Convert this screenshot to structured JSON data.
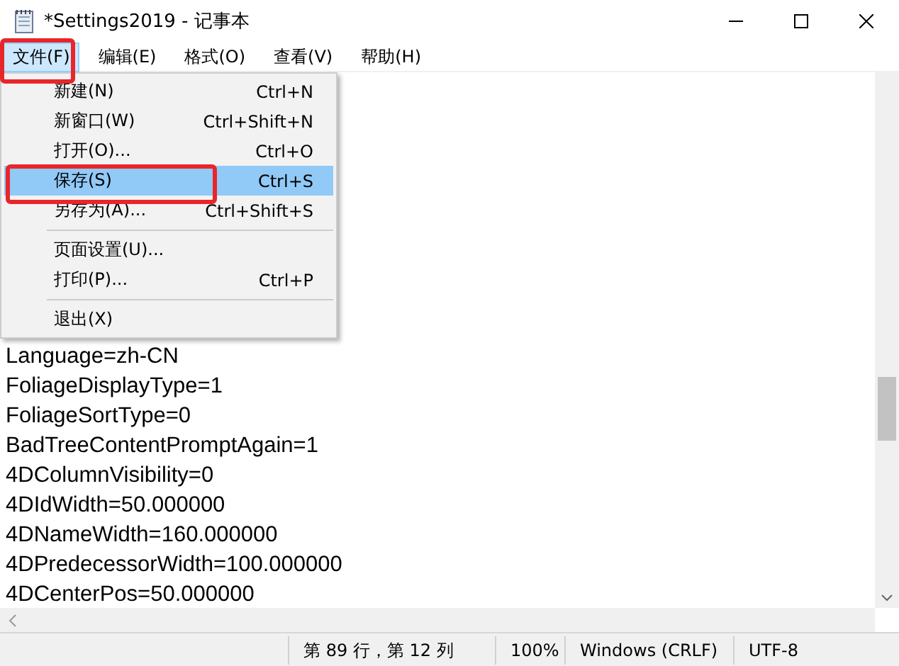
{
  "window": {
    "title": "*Settings2019 - 记事本"
  },
  "menu_bar": [
    {
      "label": "文件(F)",
      "selected": true
    },
    {
      "label": "编辑(E)",
      "selected": false
    },
    {
      "label": "格式(O)",
      "selected": false
    },
    {
      "label": "查看(V)",
      "selected": false
    },
    {
      "label": "帮助(H)",
      "selected": false
    }
  ],
  "file_menu": [
    {
      "kind": "item",
      "label": "新建(N)",
      "shortcut": "Ctrl+N",
      "selected": false
    },
    {
      "kind": "item",
      "label": "新窗口(W)",
      "shortcut": "Ctrl+Shift+N",
      "selected": false
    },
    {
      "kind": "item",
      "label": "打开(O)...",
      "shortcut": "Ctrl+O",
      "selected": false
    },
    {
      "kind": "item",
      "label": "保存(S)",
      "shortcut": "Ctrl+S",
      "selected": true
    },
    {
      "kind": "item",
      "label": "另存为(A)...",
      "shortcut": "Ctrl+Shift+S",
      "selected": false
    },
    {
      "kind": "separator"
    },
    {
      "kind": "item",
      "label": "页面设置(U)...",
      "selected": false
    },
    {
      "kind": "item",
      "label": "打印(P)...",
      "shortcut": "Ctrl+P",
      "selected": false
    },
    {
      "kind": "separator"
    },
    {
      "kind": "item",
      "label": "退出(X)",
      "selected": false
    }
  ],
  "editor_lines": [
    "Language=zh-CN",
    "FoliageDisplayType=1",
    "FoliageSortType=0",
    "BadTreeContentPromptAgain=1",
    "4DColumnVisibility=0",
    "4DIdWidth=50.000000",
    "4DNameWidth=160.000000",
    "4DPredecessorWidth=100.000000",
    "4DCenterPos=50.000000"
  ],
  "status_bar": {
    "position": "第 89 行，第 12 列",
    "zoom": "100%",
    "line_ending": "Windows (CRLF)",
    "encoding": "UTF-8"
  }
}
